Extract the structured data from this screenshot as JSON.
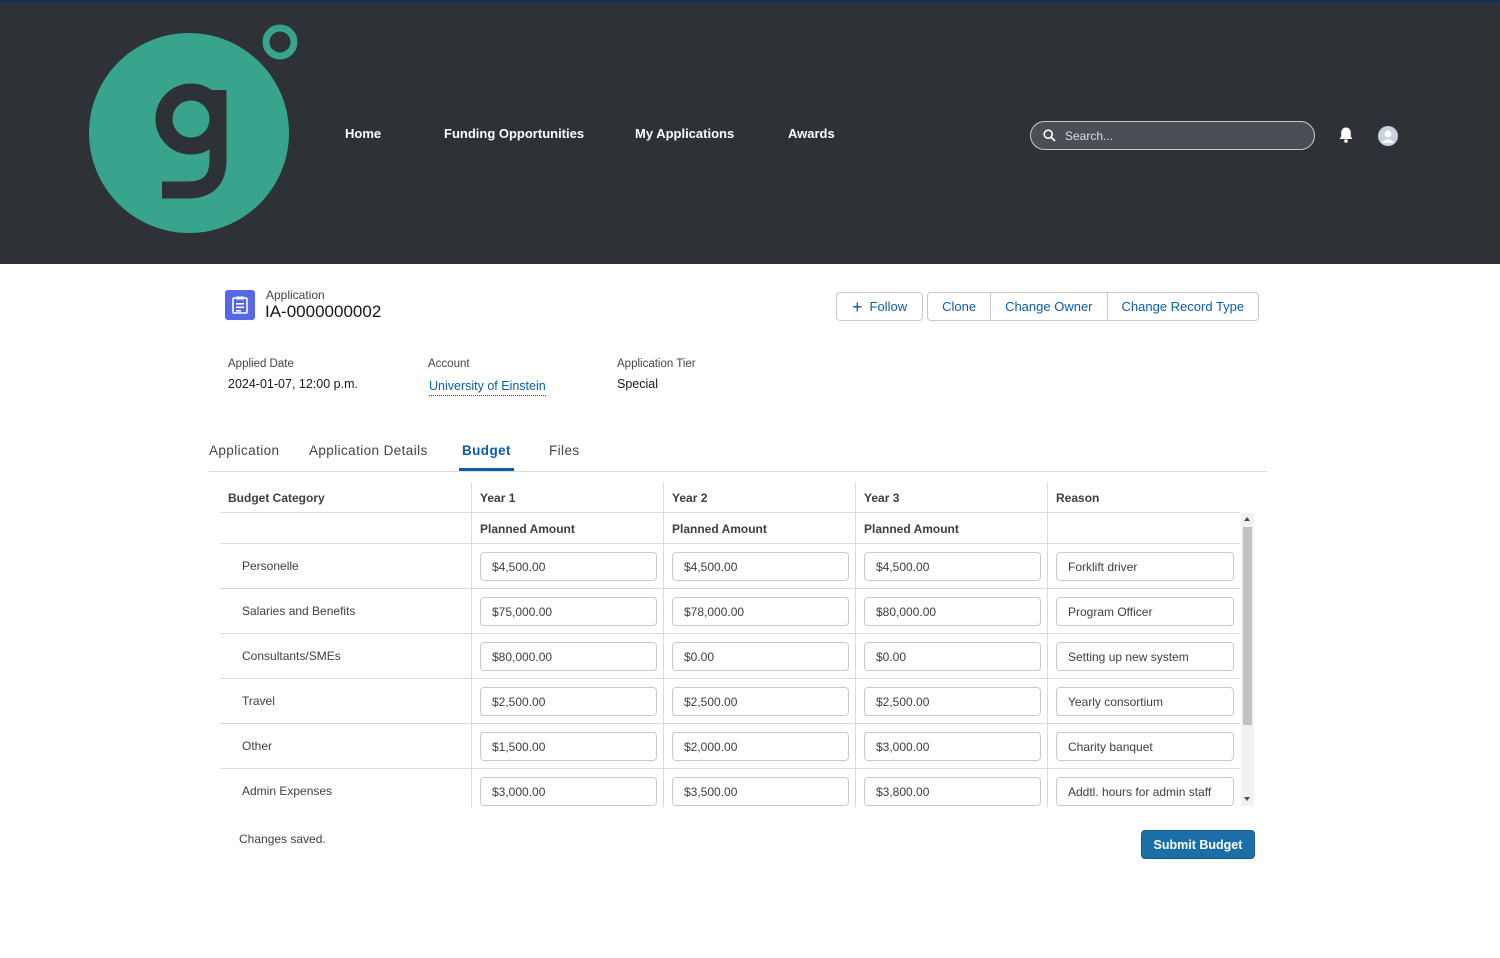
{
  "colors": {
    "header_bg": "#2e3136",
    "brand_teal": "#37a48b",
    "link": "#0b5cab",
    "primary_button": "#1b6ea8",
    "record_icon": "#5867e8"
  },
  "logo": {
    "letter": "g",
    "icon": "brand-logo"
  },
  "nav": {
    "items": [
      {
        "label": "Home"
      },
      {
        "label": "Funding Opportunities"
      },
      {
        "label": "My Applications"
      },
      {
        "label": "Awards"
      }
    ]
  },
  "search": {
    "placeholder": "Search...",
    "icon": "search-icon"
  },
  "header_icons": {
    "notifications": "bell-icon",
    "user": "user-avatar-icon"
  },
  "record": {
    "type_label": "Application",
    "name": "IA-0000000002",
    "icon": "application-record-icon"
  },
  "actions": {
    "follow": "Follow",
    "clone": "Clone",
    "change_owner": "Change Owner",
    "change_record_type": "Change Record Type"
  },
  "fields": [
    {
      "label": "Applied Date",
      "value": "2024-01-07, 12:00 p.m."
    },
    {
      "label": "Account",
      "value": "University of Einstein"
    },
    {
      "label": "Application Tier",
      "value": "Special"
    }
  ],
  "tabs": [
    {
      "label": "Application"
    },
    {
      "label": "Application Details"
    },
    {
      "label": "Budget",
      "active": true
    },
    {
      "label": "Files"
    }
  ],
  "budget": {
    "headers": [
      "Budget Category",
      "Year 1",
      "Year 2",
      "Year 3",
      "Reason"
    ],
    "subheaders": [
      "",
      "Planned Amount",
      "Planned Amount",
      "Planned Amount",
      ""
    ],
    "rows": [
      {
        "category": "Personelle",
        "y1": "$4,500.00",
        "y2": "$4,500.00",
        "y3": "$4,500.00",
        "reason": "Forklift driver"
      },
      {
        "category": "Salaries and Benefits",
        "y1": "$75,000.00",
        "y2": "$78,000.00",
        "y3": "$80,000.00",
        "reason": "Program Officer"
      },
      {
        "category": "Consultants/SMEs",
        "y1": "$80,000.00",
        "y2": "$0.00",
        "y3": "$0.00",
        "reason": "Setting up new system"
      },
      {
        "category": "Travel",
        "y1": "$2,500.00",
        "y2": "$2,500.00",
        "y3": "$2,500.00",
        "reason": "Yearly consortium"
      },
      {
        "category": "Other",
        "y1": "$1,500.00",
        "y2": "$2,000.00",
        "y3": "$3,000.00",
        "reason": "Charity banquet"
      },
      {
        "category": "Admin Expenses",
        "y1": "$3,000.00",
        "y2": "$3,500.00",
        "y3": "$3,800.00",
        "reason": "Addtl. hours for admin staff"
      }
    ]
  },
  "status_text": "Changes saved.",
  "submit_label": "Submit Budget"
}
